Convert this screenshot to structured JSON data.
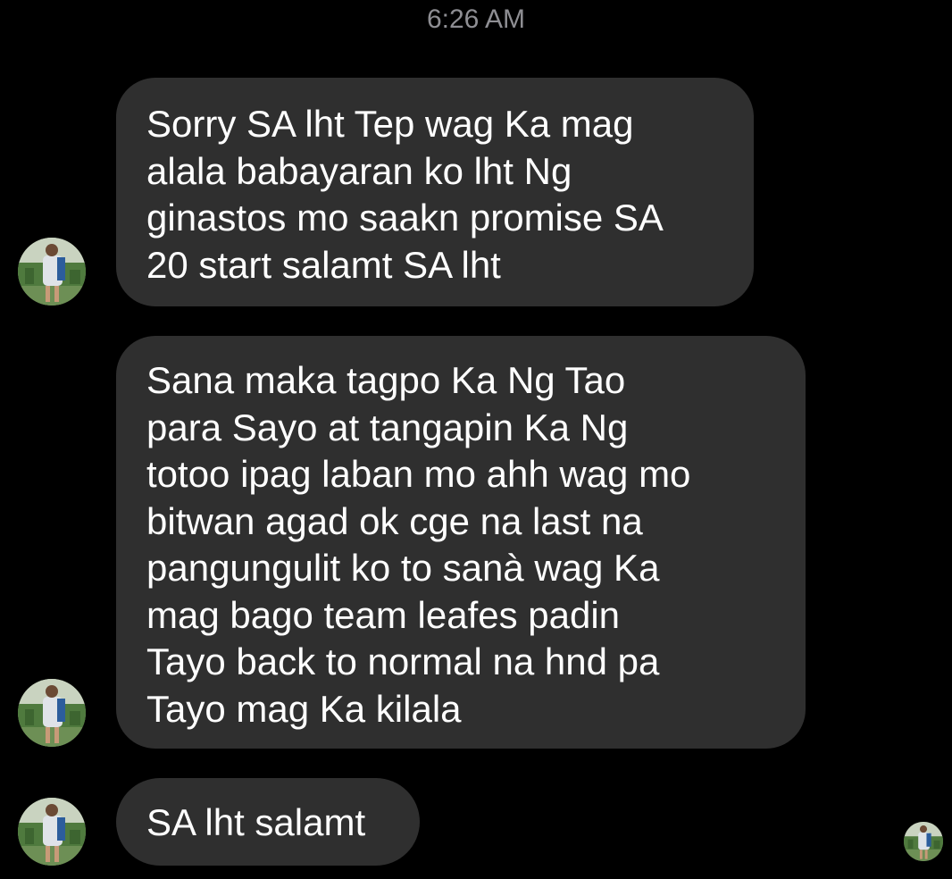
{
  "thread": {
    "timestamp": "6:26 AM",
    "messages": [
      {
        "sender": "other",
        "text": "Sorry SA lht Tep wag Ka mag\nalala babayaran ko lht Ng\nginastos mo saakn promise SA\n20 start salamt SA lht"
      },
      {
        "sender": "other",
        "text": "Sana maka tagpo Ka Ng Tao\npara Sayo at tangapin Ka Ng\ntotoo ipag laban mo ahh wag mo\nbitwan agad ok cge na last na\npangungulit ko to sanà wag Ka\nmag bago team leafes padin\nTayo back to normal na hnd pa\nTayo mag Ka kilala"
      },
      {
        "sender": "other",
        "text": "SA lht salamt"
      }
    ]
  },
  "colors": {
    "background": "#000000",
    "bubble": "#2f2f2f",
    "text": "#ffffff",
    "timestamp": "#8e8e93"
  },
  "icons": {
    "sender_avatar": "profile-photo-avatar",
    "read_receipt": "read-receipt-avatar"
  }
}
